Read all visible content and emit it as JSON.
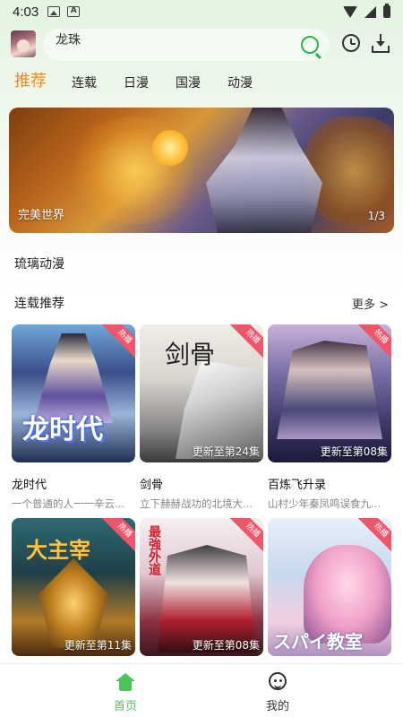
{
  "status_bar": {
    "time": "4:03"
  },
  "header": {
    "search_value": "龙珠",
    "icons": [
      "search-icon",
      "history-icon",
      "download-icon"
    ]
  },
  "tabs": [
    {
      "label": "推荐",
      "active": true
    },
    {
      "label": "连载",
      "active": false
    },
    {
      "label": "日漫",
      "active": false
    },
    {
      "label": "国漫",
      "active": false
    },
    {
      "label": "动漫",
      "active": false
    }
  ],
  "banner": {
    "title": "完美世界",
    "index": "1/3"
  },
  "sections": {
    "site_name": "琉璃动漫",
    "serial_title": "连载推荐",
    "more_label": "更多 >"
  },
  "cards": [
    {
      "title": "龙时代",
      "subtitle": "一个普通的人一一辛云...",
      "episode": "",
      "badge": "热播",
      "poster_text": "龙时代"
    },
    {
      "title": "剑骨",
      "subtitle": "立下赫赫战功的北境大...",
      "episode": "更新至第24集",
      "badge": "热播",
      "poster_text": "剑骨"
    },
    {
      "title": "百炼飞升录",
      "subtitle": "山村少年秦凤鸣误食九...",
      "episode": "更新至第08集",
      "badge": "热播",
      "poster_text": ""
    },
    {
      "title": "",
      "subtitle": "",
      "episode": "更新至第11集",
      "badge": "热播",
      "poster_text": "大主宰"
    },
    {
      "title": "",
      "subtitle": "",
      "episode": "更新至第08集",
      "badge": "热播",
      "poster_text": "最強外道"
    },
    {
      "title": "",
      "subtitle": "",
      "episode": "",
      "badge": "热播",
      "poster_text": "スパイ教室"
    }
  ],
  "bottom_nav": [
    {
      "label": "首页",
      "active": true,
      "color": "#4cc45a"
    },
    {
      "label": "我的",
      "active": false,
      "color": "#333333"
    }
  ],
  "colors": {
    "accent": "#f08a1c",
    "brand_green": "#29b34a",
    "hot_badge": "#f0556a"
  }
}
